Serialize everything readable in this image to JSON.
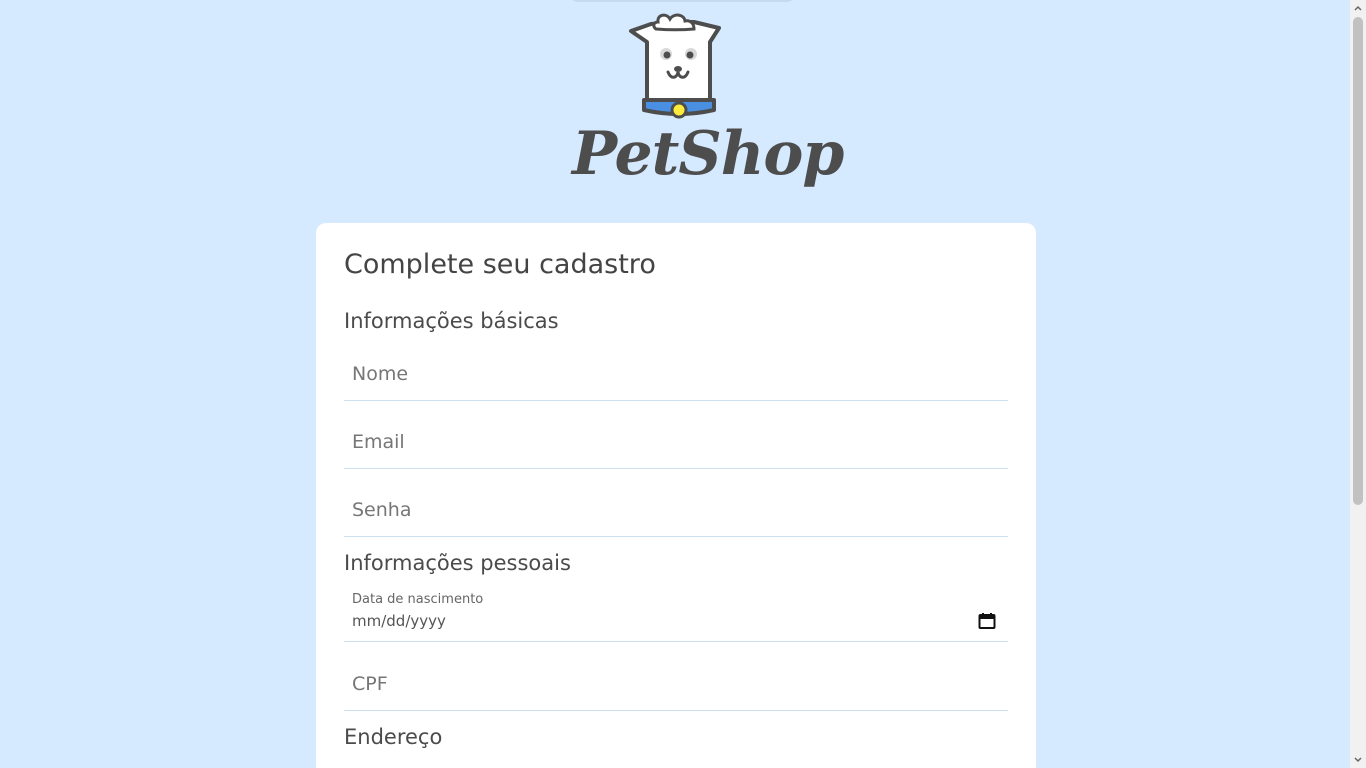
{
  "brand": {
    "name": "PetShop",
    "logo_icon": "dog-logo-icon"
  },
  "form": {
    "title": "Complete seu cadastro",
    "sections": {
      "basic": "Informações básicas",
      "personal": "Informações pessoais",
      "address": "Endereço"
    },
    "fields": {
      "nome": {
        "placeholder": "Nome",
        "value": ""
      },
      "email": {
        "placeholder": "Email",
        "value": ""
      },
      "senha": {
        "placeholder": "Senha",
        "value": ""
      },
      "data_nascimento": {
        "label": "Data de nascimento",
        "value": "mm/dd/yyyy",
        "icon": "calendar-icon"
      },
      "cpf": {
        "placeholder": "CPF",
        "value": ""
      }
    }
  },
  "colors": {
    "page_background": "#d5e9ff",
    "card_background": "#ffffff",
    "collar_blue": "#4a90e2",
    "collar_tag_yellow": "#ffeb3b",
    "text_primary": "#444444"
  }
}
